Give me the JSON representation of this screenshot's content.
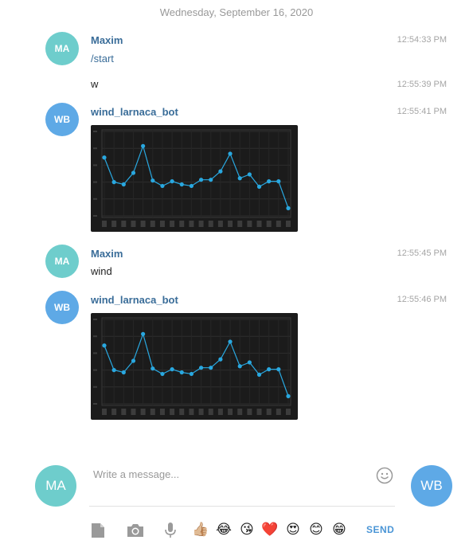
{
  "date_separator": "Wednesday, September 16, 2020",
  "messages": [
    {
      "author": "Maxim",
      "avatar": "MA",
      "time": "12:54:33 PM",
      "text": "/start"
    },
    {
      "text": "w",
      "time": "12:55:39 PM"
    },
    {
      "author": "wind_larnaca_bot",
      "avatar": "WB",
      "time": "12:55:41 PM",
      "attachment": "photo"
    },
    {
      "author": "Maxim",
      "avatar": "MA",
      "time": "12:55:45 PM",
      "text": "wind"
    },
    {
      "author": "wind_larnaca_bot",
      "avatar": "WB",
      "time": "12:55:46 PM",
      "attachment": "photo"
    }
  ],
  "chart_data": [
    {
      "type": "line",
      "values": [
        7.6,
        4.4,
        4.1,
        5.6,
        9.1,
        4.6,
        3.9,
        4.5,
        4.1,
        3.9,
        4.7,
        4.7,
        5.8,
        8.1,
        4.9,
        5.4,
        3.8,
        4.5,
        4.5,
        1.0
      ],
      "ylim": [
        0,
        11
      ],
      "grid": true
    },
    {
      "type": "line",
      "values": [
        7.6,
        4.4,
        4.1,
        5.6,
        9.1,
        4.6,
        3.9,
        4.5,
        4.1,
        3.9,
        4.7,
        4.7,
        5.8,
        8.1,
        4.9,
        5.4,
        3.8,
        4.5,
        4.5,
        1.0
      ],
      "ylim": [
        0,
        11
      ],
      "grid": true
    }
  ],
  "composer": {
    "placeholder": "Write a message...",
    "left_avatar": "MA",
    "right_avatar": "WB",
    "send_label": "SEND",
    "emojis": [
      "👍🏼",
      "😂",
      "😘",
      "❤️",
      "😍",
      "😊",
      "😁"
    ]
  },
  "colors": {
    "accent": "#4a95d6",
    "author": "#3a6d99",
    "avatar_ma": "#6ecdcc",
    "avatar_wb": "#5ea9e6",
    "chart_line": "#29a8e0",
    "chart_bg": "#1b1b1b"
  },
  "icons": [
    "document-icon",
    "camera-icon",
    "microphone-icon",
    "smile-icon"
  ]
}
